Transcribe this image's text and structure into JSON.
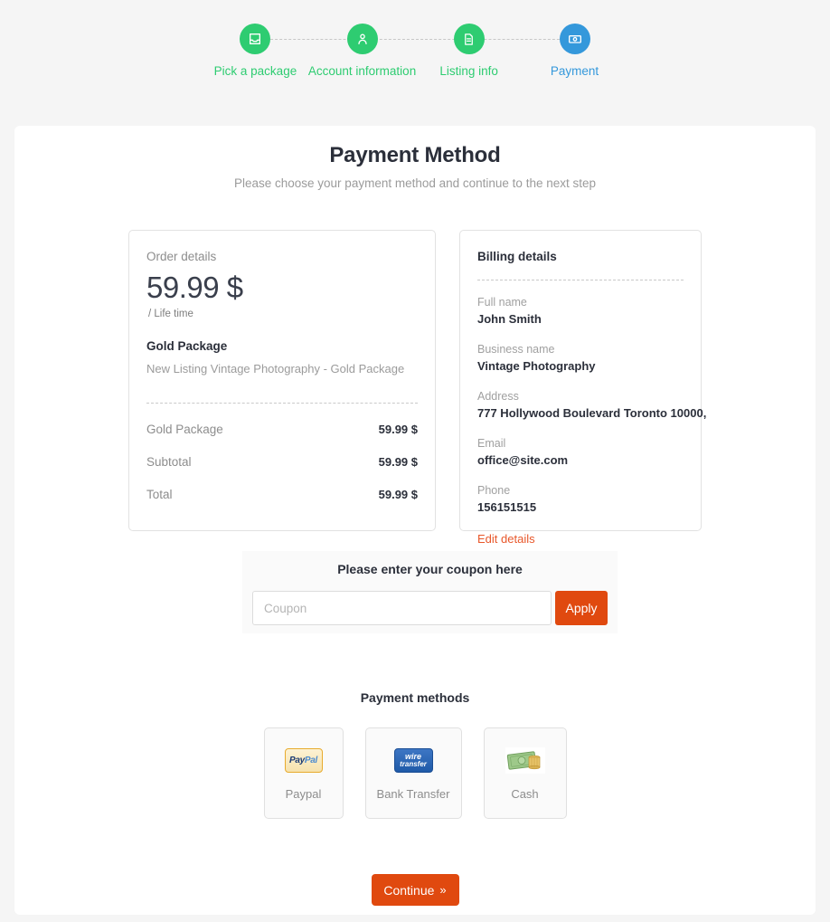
{
  "stepper": {
    "steps": [
      {
        "label": "Pick a package",
        "icon": "inbox-icon",
        "state": "done"
      },
      {
        "label": "Account information",
        "icon": "user-icon",
        "state": "done"
      },
      {
        "label": "Listing info",
        "icon": "document-icon",
        "state": "done"
      },
      {
        "label": "Payment",
        "icon": "money-icon",
        "state": "active"
      }
    ],
    "done_color": "#2ecc71",
    "active_color": "#3498db"
  },
  "page": {
    "title": "Payment Method",
    "subtitle": "Please choose your payment method and continue to the next step"
  },
  "order": {
    "heading": "Order details",
    "price": "59.99 $",
    "period": "/ Life time",
    "package_name": "Gold Package",
    "package_description": "New Listing Vintage Photography - Gold Package",
    "lines": [
      {
        "label": "Gold Package",
        "value": "59.99 $"
      },
      {
        "label": "Subtotal",
        "value": "59.99 $"
      },
      {
        "label": "Total",
        "value": "59.99 $"
      }
    ]
  },
  "billing": {
    "heading": "Billing details",
    "fields": [
      {
        "label": "Full name",
        "value": "John Smith"
      },
      {
        "label": "Business name",
        "value": "Vintage Photography"
      },
      {
        "label": "Address",
        "value": "777 Hollywood Boulevard Toronto 10000,"
      },
      {
        "label": "Email",
        "value": "office@site.com"
      },
      {
        "label": "Phone",
        "value": "156151515"
      }
    ],
    "edit_link": "Edit details",
    "edit_link_color": "#e8572a"
  },
  "coupon": {
    "title": "Please enter your coupon here",
    "placeholder": "Coupon",
    "value": "",
    "apply_label": "Apply",
    "apply_color": "#e0490f"
  },
  "payment_methods": {
    "title": "Payment methods",
    "items": [
      {
        "label": "Paypal",
        "logo": "paypal-logo"
      },
      {
        "label": "Bank Transfer",
        "logo": "wire-transfer-logo"
      },
      {
        "label": "Cash",
        "logo": "cash-logo"
      }
    ]
  },
  "footer": {
    "continue_label": "Continue",
    "continue_chevron": "»",
    "continue_color": "#e0490f"
  }
}
